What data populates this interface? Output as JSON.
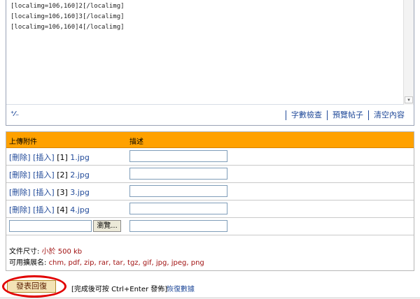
{
  "editor": {
    "lines": [
      "[localimg=106,160]2[/localimg]",
      "[localimg=106,160]3[/localimg]",
      "[localimg=106,160]4[/localimg]"
    ],
    "resize_glyph": "⁺⁄₋",
    "buttons": [
      "字數檢查",
      "預覽帖子",
      "清空內容"
    ]
  },
  "attachments": {
    "col_upload": "上傳附件",
    "col_desc": "描述",
    "delete_label": "[刪除]",
    "insert_label": "[插入]",
    "files": [
      {
        "index": "[1]",
        "name": "1.jpg"
      },
      {
        "index": "[2]",
        "name": "2.jpg"
      },
      {
        "index": "[3]",
        "name": "3.jpg"
      },
      {
        "index": "[4]",
        "name": "4.jpg"
      }
    ],
    "browse_label": "瀏覽...",
    "size_label": "文件尺寸:",
    "size_value": "小於 500 kb",
    "ext_label": "可用擴展名:",
    "ext_value": "chm, pdf, zip, rar, tar, tgz, gif, jpg, jpeg, png"
  },
  "footer": {
    "submit_label": "發表回復",
    "hint": "[完成後可按 Ctrl+Enter 發佈]",
    "restore_label": "恢復數據"
  },
  "colors": {
    "header_bg": "#ffa100",
    "link": "#224b9a",
    "highlight": "#e10000"
  }
}
